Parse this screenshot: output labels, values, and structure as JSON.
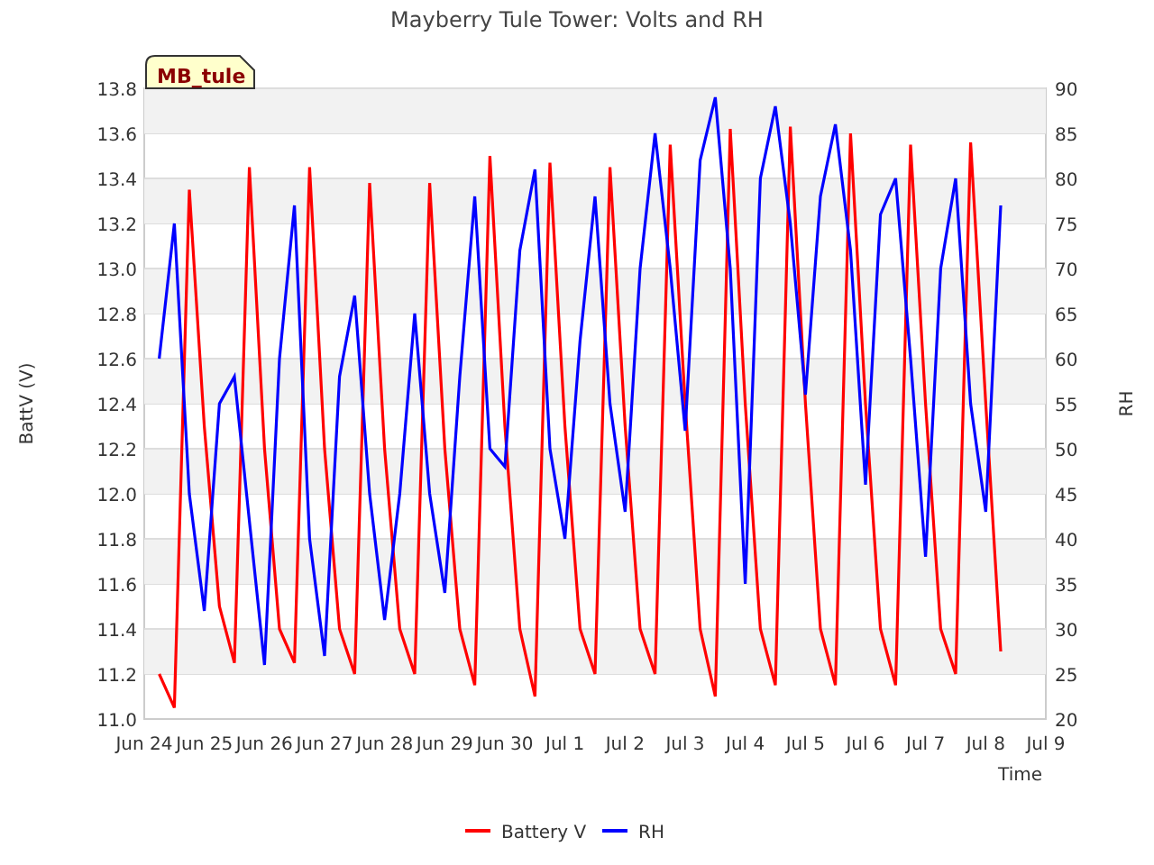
{
  "chart": {
    "badge": "MB_tule",
    "chart_data": {
      "type": "line",
      "title": "Mayberry Tule Tower: Volts and RH",
      "xlabel": "Time",
      "ylabel": "BattV (V)",
      "y2label": "RH",
      "y2lim": [
        20,
        90
      ],
      "y2ticks": [
        20,
        25,
        30,
        35,
        40,
        45,
        50,
        55,
        60,
        65,
        70,
        75,
        80,
        85,
        90
      ],
      "categories": [
        "Jun 24",
        null,
        null,
        null,
        "Jun 25",
        null,
        null,
        null,
        "Jun 26",
        null,
        null,
        null,
        "Jun 27",
        null,
        null,
        null,
        "Jun 28",
        null,
        null,
        null,
        "Jun 29",
        null,
        null,
        null,
        "Jun 30",
        null,
        null,
        null,
        "Jul 1",
        null,
        null,
        null,
        "Jul 2",
        null,
        null,
        null,
        "Jul 3",
        null,
        null,
        null,
        "Jul 4",
        null,
        null,
        null,
        "Jul 5",
        null,
        null,
        null,
        "Jul 6",
        null,
        null,
        null,
        "Jul 7",
        null,
        null,
        null,
        "Jul 8",
        null,
        null,
        null,
        "Jul 9"
      ],
      "series": [
        {
          "name": "Battery V",
          "color": "#ff0000",
          "values": [
            null,
            11.2,
            11.05,
            13.35,
            12.3,
            11.5,
            11.25,
            13.45,
            12.2,
            11.4,
            11.25,
            13.45,
            12.2,
            11.4,
            11.2,
            13.38,
            12.2,
            11.4,
            11.2,
            13.38,
            12.2,
            11.4,
            11.15,
            13.5,
            12.3,
            11.4,
            11.1,
            13.47,
            12.3,
            11.4,
            11.2,
            13.45,
            12.3,
            11.4,
            11.2,
            13.55,
            12.4,
            11.4,
            11.1,
            13.62,
            12.4,
            11.4,
            11.15,
            13.63,
            12.4,
            11.4,
            11.15,
            13.6,
            12.4,
            11.4,
            11.15,
            13.55,
            12.4,
            11.4,
            11.2,
            13.56,
            12.4,
            11.3,
            null,
            null,
            null
          ]
        },
        {
          "name": "RH",
          "color": "#0000ff",
          "axis": "y2",
          "values": [
            null,
            60,
            75,
            45,
            32,
            55,
            58,
            42,
            26,
            60,
            77,
            40,
            27,
            58,
            67,
            45,
            31,
            45,
            65,
            45,
            34,
            58,
            78,
            50,
            48,
            72,
            81,
            50,
            40,
            62,
            78,
            55,
            43,
            70,
            85,
            70,
            52,
            82,
            89,
            70,
            35,
            80,
            88,
            75,
            56,
            78,
            86,
            72,
            46,
            76,
            80,
            60,
            38,
            70,
            80,
            55,
            43,
            77,
            null,
            null,
            null
          ]
        }
      ],
      "ylim": [
        11.0,
        13.8
      ],
      "grid": true,
      "legend": "bottom",
      "yticks": [
        {
          "value": 11.0,
          "label": "11.0"
        },
        {
          "value": 11.2,
          "label": "11.2"
        },
        {
          "value": 11.4,
          "label": "11.4"
        },
        {
          "value": 11.6,
          "label": "11.6"
        },
        {
          "value": 11.8,
          "label": "11.8"
        },
        {
          "value": 12.0,
          "label": "12.0"
        },
        {
          "value": 12.2,
          "label": "12.2"
        },
        {
          "value": 12.4,
          "label": "12.4"
        },
        {
          "value": 12.6,
          "label": "12.6"
        },
        {
          "value": 12.8,
          "label": "12.8"
        },
        {
          "value": 13.0,
          "label": "13.0"
        },
        {
          "value": 13.2,
          "label": "13.2"
        },
        {
          "value": 13.4,
          "label": "13.4"
        },
        {
          "value": 13.6,
          "label": "13.6"
        },
        {
          "value": 13.8,
          "label": "13.8"
        }
      ]
    }
  }
}
